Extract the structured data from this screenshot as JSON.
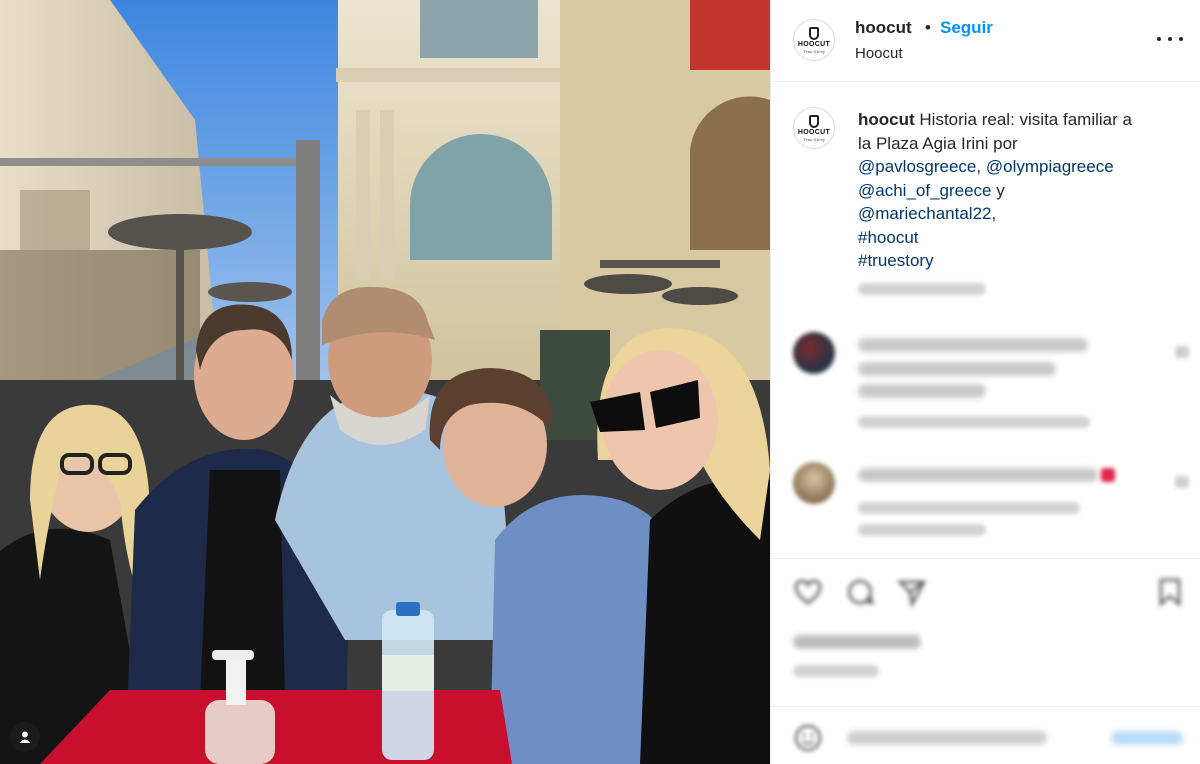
{
  "post": {
    "author": {
      "username": "hoocut",
      "display_name": "Hoocut",
      "follow_label": "Seguir",
      "separator": "•",
      "logo_text": "HOOCUT",
      "logo_subtext": "True Story"
    },
    "caption": {
      "username": "hoocut",
      "line1": "Historia real: visita familiar a",
      "line2": "la Plaza Agia Irini por",
      "mention1": "@pavlosgreece",
      "comma1": ",",
      "mention2": "@olympiagreece",
      "mention3": "@achi_of_greece",
      "conj": "y",
      "mention4": "@mariechantal22",
      "comma2": ",",
      "hashtag1": "#hoocut",
      "hashtag2": "#truestory"
    }
  },
  "colors": {
    "link_blue": "#0095f6",
    "mention": "#00376b",
    "text": "#262626",
    "heart_emoji": "#e0244a"
  },
  "icons": [
    "more-options-icon",
    "heart-icon",
    "comment-icon",
    "share-icon",
    "bookmark-icon",
    "user-tag-icon"
  ]
}
